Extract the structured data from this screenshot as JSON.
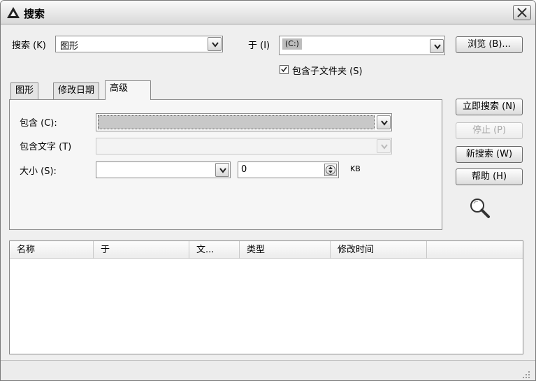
{
  "window": {
    "title": "搜索"
  },
  "search_row": {
    "search_label": "搜索 (K)",
    "search_value": "图形",
    "in_label": "于 (I)",
    "in_value": "(C:)",
    "browse_label": "浏览 (B)...",
    "subfolder_label": "包含子文件夹 (S)",
    "subfolder_checked": true
  },
  "tabs": [
    {
      "label": "图形",
      "active": false
    },
    {
      "label": "修改日期",
      "active": false
    },
    {
      "label": "高级",
      "active": true
    }
  ],
  "advanced": {
    "contains_label": "包含 (C):",
    "contains_value": "",
    "contains_text_label": "包含文字 (T)",
    "contains_text_value": "",
    "size_label": "大小 (S):",
    "size_mode_value": "",
    "size_value": "0",
    "size_unit": "KB"
  },
  "actions": {
    "search_now": "立即搜索 (N)",
    "stop": "停止 (P)",
    "new_search": "新搜索 (W)",
    "help": "帮助 (H)"
  },
  "results": {
    "columns": [
      "名称",
      "于",
      "文...",
      "类型",
      "修改时间"
    ],
    "rows": []
  },
  "icons": {
    "app": "autocad-a-icon",
    "close": "close-icon",
    "magnifier": "magnifier-icon",
    "dropdown": "chevron-down-icon",
    "spinner": "spinner-updown-icon",
    "grip": "resize-grip-icon"
  },
  "colors": {
    "window_bg": "#efefef",
    "panel_bg": "#f6f6f6",
    "border": "#8a8a8a",
    "disabled_text": "#a8a8a8"
  }
}
